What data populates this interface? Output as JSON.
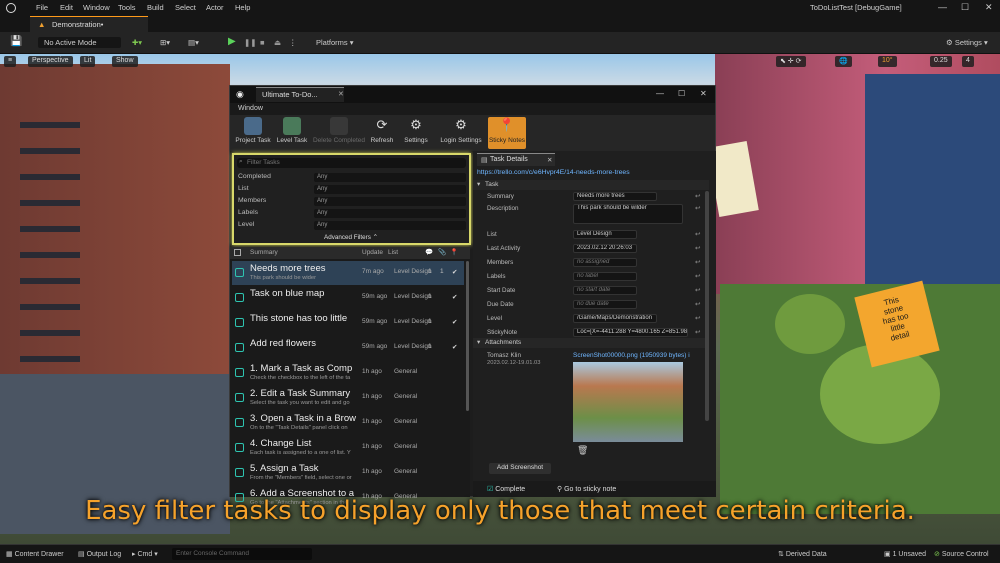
{
  "menubar": {
    "items": [
      "File",
      "Edit",
      "Window",
      "Tools",
      "Build",
      "Select",
      "Actor",
      "Help"
    ],
    "window_title": "ToDoListTest [DebugGame]"
  },
  "tab": {
    "label": "Demonstration•"
  },
  "toolbar": {
    "mode": "No Active Mode",
    "platforms": "Platforms",
    "settings": "Settings"
  },
  "viewport": {
    "perspective": "Perspective",
    "lit": "Lit",
    "show": "Show",
    "snap_angle": "10°",
    "snap_scale": "0.25",
    "cam_speed": "4"
  },
  "todo": {
    "title": "Ultimate To-Do...",
    "menu": "Window",
    "tools": [
      "Project Task",
      "Level Task",
      "Delete Completed",
      "Refresh",
      "Settings",
      "Login Settings",
      "Sticky Notes"
    ],
    "filter": {
      "placeholder": "Filter Tasks",
      "rows": [
        {
          "label": "Completed",
          "value": "Any"
        },
        {
          "label": "List",
          "value": "Any"
        },
        {
          "label": "Members",
          "value": "Any"
        },
        {
          "label": "Labels",
          "value": "Any"
        },
        {
          "label": "Level",
          "value": "Any"
        }
      ],
      "advanced": "Advanced Filters"
    },
    "list_header": {
      "summary": "Summary",
      "updated": "Update",
      "list": "List"
    },
    "tasks": [
      {
        "title": "Needs more trees",
        "sub": "This park should be wider",
        "time": "7m ago",
        "list": "Level Design",
        "n1": "1",
        "n2": "1",
        "done": "✔"
      },
      {
        "title": "Task on blue map",
        "sub": "",
        "time": "59m ago",
        "list": "Level Design",
        "n1": "1",
        "n2": "",
        "done": "✔"
      },
      {
        "title": "This stone has too little",
        "sub": "",
        "time": "59m ago",
        "list": "Level Design",
        "n1": "1",
        "n2": "",
        "done": "✔"
      },
      {
        "title": "Add red flowers",
        "sub": "",
        "time": "59m ago",
        "list": "Level Design",
        "n1": "1",
        "n2": "",
        "done": "✔"
      },
      {
        "title": "1. Mark a Task as Comp",
        "sub": "Check the checkbox to the left of the ta",
        "time": "1h ago",
        "list": "General",
        "n1": "",
        "n2": "",
        "done": ""
      },
      {
        "title": "2. Edit a Task Summary",
        "sub": "Select the task you want to edit and go",
        "time": "1h ago",
        "list": "General",
        "n1": "",
        "n2": "",
        "done": ""
      },
      {
        "title": "3. Open a Task in a Brow",
        "sub": "On to the \"Task Details\" panel click on",
        "time": "1h ago",
        "list": "General",
        "n1": "",
        "n2": "",
        "done": ""
      },
      {
        "title": "4. Change List",
        "sub": "Each task is assigned to a one of list. Y",
        "time": "1h ago",
        "list": "General",
        "n1": "",
        "n2": "",
        "done": ""
      },
      {
        "title": "5. Assign a Task",
        "sub": "From the \"Members\" field, select one or",
        "time": "1h ago",
        "list": "General",
        "n1": "",
        "n2": "",
        "done": ""
      },
      {
        "title": "6. Add a Screenshot to a",
        "sub": "Go to the \"Attachments\" section in the",
        "time": "1h ago",
        "list": "General",
        "n1": "",
        "n2": "",
        "done": ""
      }
    ],
    "details": {
      "tab": "Task Details",
      "url": "https://trello.com/c/e6Hvpr4E/14-needs-more-trees",
      "section_task": "Task",
      "fields": [
        {
          "label": "Summary",
          "value": "Needs more trees"
        },
        {
          "label": "Description",
          "value": "This park should be wilder"
        },
        {
          "label": "List",
          "value": "Level Design"
        },
        {
          "label": "Last Activity",
          "value": "2023.02.12 20:26:03"
        },
        {
          "label": "Members",
          "value": "no assigned"
        },
        {
          "label": "Labels",
          "value": "no label"
        },
        {
          "label": "Start Date",
          "value": "no start date"
        },
        {
          "label": "Due Date",
          "value": "no due date"
        },
        {
          "label": "Level",
          "value": "/Game/Maps/Demonstration"
        },
        {
          "label": "StickyNote",
          "value": "Loc=[X=-4411.288 Y=4800.165 Z=851.982]"
        }
      ],
      "section_attach": "Attachments",
      "author": "Tomasz Klin",
      "author_date": "2023.02.12-19.01.03",
      "file": "ScreenShot00000.png (1950939 bytes) i",
      "add_screenshot": "Add Screenshot",
      "complete": "Complete",
      "goto_note": "Go to sticky note"
    }
  },
  "sticky_note_text": "This stone has too little detail",
  "caption": "Easy filter tasks to display only those that meet certain criteria.",
  "statusbar": {
    "content_drawer": "Content Drawer",
    "output_log": "Output Log",
    "cmd": "Cmd",
    "console_placeholder": "Enter Console Command",
    "derived": "Derived Data",
    "unsaved": "1 Unsaved",
    "source": "Source Control"
  }
}
